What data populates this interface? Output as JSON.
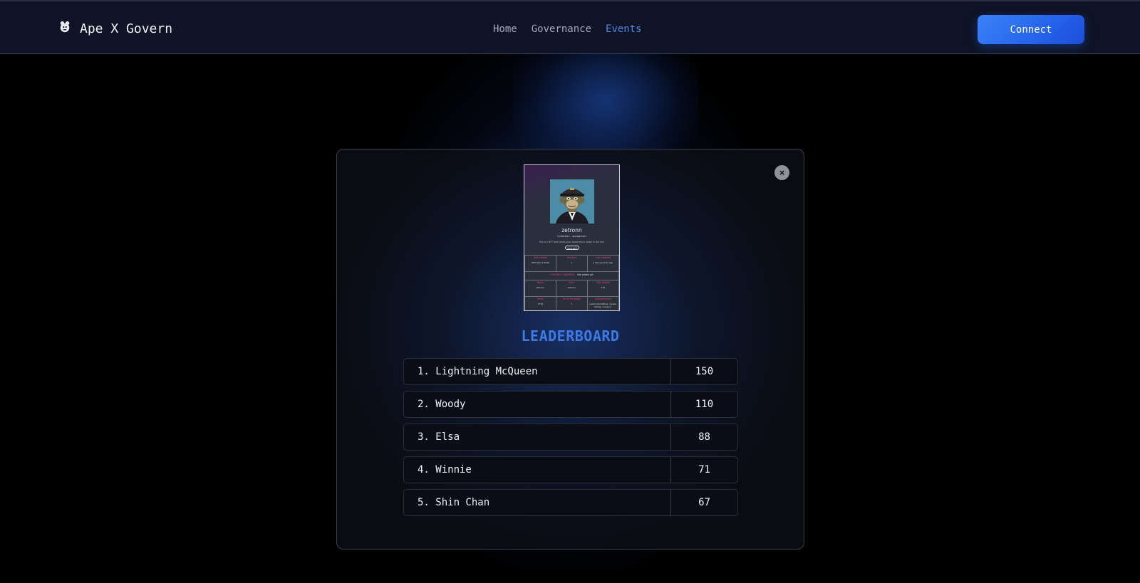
{
  "navbar": {
    "brand_icon": "ape-logo-icon",
    "brand_name": "Ape X Govern",
    "links": [
      {
        "label": "Home",
        "active": false
      },
      {
        "label": "Governance",
        "active": false
      },
      {
        "label": "Events",
        "active": true
      }
    ],
    "connect_label": "Connect"
  },
  "modal": {
    "close_label": "×",
    "nft_card": {
      "name": "zetronn",
      "collection": "Collection : apeagentrr",
      "description": "this is a NFT that shows your governance power in the dao",
      "view_label": "View NFT",
      "grid": {
        "date_added": {
          "label": "Date Added",
          "value": "25th March 2025"
        },
        "versions": {
          "label": "Versions",
          "value": "1"
        },
        "last_updated": {
          "label": "Last Updated",
          "value": "a few seconds ago"
        },
        "contract_address": {
          "label": "CONTRACT ADDRESS",
          "value": "Not added yet"
        },
        "name": {
          "label": "Name",
          "value": "zetronn"
        },
        "rank": {
          "label": "Rank",
          "value": "zetronn"
        },
        "vote_weight": {
          "label": "Vote Weight",
          "value": "125"
        },
        "points": {
          "label": "Points",
          "value": "1778"
        },
        "proposals": {
          "label": "No Of Proposals",
          "value": "7"
        },
        "achievements": {
          "label": "Achievements",
          "value": "web3-marketting, media-listing, survey-2"
        }
      }
    },
    "leaderboard": {
      "title": "LEADERBOARD",
      "rows": [
        {
          "name": "1. Lightning McQueen",
          "score": "150"
        },
        {
          "name": "2. Woody",
          "score": "110"
        },
        {
          "name": "3. Elsa",
          "score": "88"
        },
        {
          "name": "4. Winnie",
          "score": "71"
        },
        {
          "name": "5. Shin Chan",
          "score": "67"
        }
      ]
    }
  },
  "colors": {
    "accent": "#3d7ae6",
    "nav_active": "#4d86ea",
    "nft_label": "#e93b7b",
    "button": "#2563eb"
  }
}
